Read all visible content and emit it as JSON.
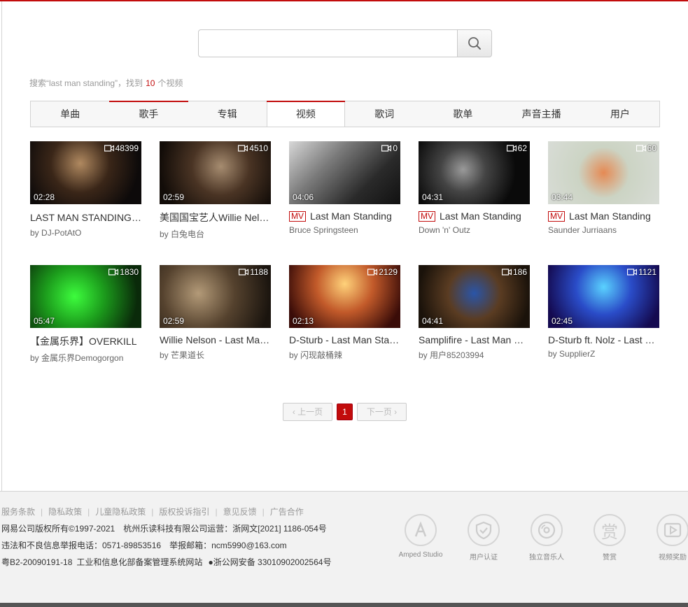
{
  "search": {
    "value": "",
    "placeholder": ""
  },
  "result_info": {
    "prefix": "搜索“last man standing”，找到",
    "count": "10",
    "suffix": "个视频"
  },
  "tabs": [
    "单曲",
    "歌手",
    "专辑",
    "视频",
    "歌词",
    "歌单",
    "声音主播",
    "用户"
  ],
  "active_tab": "视频",
  "videos": [
    {
      "title": "LAST MAN STANDING（Hip-Hop）",
      "mv": false,
      "by": "by",
      "author": "DJ-PotAtO",
      "plays": "48399",
      "duration": "02:28"
    },
    {
      "title": "美国国宝艺人Willie Nelson",
      "mv": false,
      "by": "by",
      "author": "白兔电台",
      "plays": "4510",
      "duration": "02:59"
    },
    {
      "title": "Last Man Standing",
      "mv": true,
      "mv_label": "MV",
      "by": "",
      "author": "Bruce Springsteen",
      "plays": "0",
      "duration": "04:06"
    },
    {
      "title": "Last Man Standing",
      "mv": true,
      "mv_label": "MV",
      "by": "",
      "author": "Down 'n' Outz",
      "plays": "62",
      "duration": "04:31"
    },
    {
      "title": "Last Man Standing",
      "mv": true,
      "mv_label": "MV",
      "by": "",
      "author": "Saunder Jurriaans",
      "plays": "60",
      "duration": "03:44"
    },
    {
      "title": "【金属乐界】OVERKILL",
      "mv": false,
      "by": "by",
      "author": "金属乐界Demogorgon",
      "plays": "1830",
      "duration": "05:47"
    },
    {
      "title": "Willie Nelson - Last Man Standing",
      "mv": false,
      "by": "by",
      "author": "芒果道长",
      "plays": "1188",
      "duration": "02:59"
    },
    {
      "title": "D-Sturb - Last Man Standing",
      "mv": false,
      "by": "by",
      "author": "闪现敲桶辣",
      "plays": "2129",
      "duration": "02:13"
    },
    {
      "title": "Samplifire - Last Man Standing",
      "mv": false,
      "by": "by",
      "author": "用户85203994",
      "plays": "186",
      "duration": "04:41"
    },
    {
      "title": "D-Sturb ft. Nolz - Last Man Standing",
      "mv": false,
      "by": "by",
      "author": "SupplierZ",
      "plays": "1121",
      "duration": "02:45"
    }
  ],
  "pager": {
    "prev": "上一页",
    "page": "1",
    "next": "下一页"
  },
  "footer": {
    "links": [
      "服务条款",
      "隐私政策",
      "儿童隐私政策",
      "版权投诉指引",
      "意见反馈",
      "广告合作"
    ],
    "copyright": "网易公司版权所有©1997-2021",
    "operator": "杭州乐读科技有限公司运营：浙网文[2021] 1186-054号",
    "report_phone": "违法和不良信息举报电话：0571-89853516",
    "report_email": "举报邮箱：ncm5990@163.com",
    "icp": "粤B2-20090191-18",
    "miit": "工业和信息化部备案管理系统网站",
    "police": "浙公网安备 33010902002564号",
    "badges": [
      "Amped Studio",
      "用户认证",
      "独立音乐人",
      "赞赏",
      "视频奖励"
    ]
  },
  "colors": {
    "accent": "#c20c0c",
    "footer_bg": "#f2f2f2"
  }
}
